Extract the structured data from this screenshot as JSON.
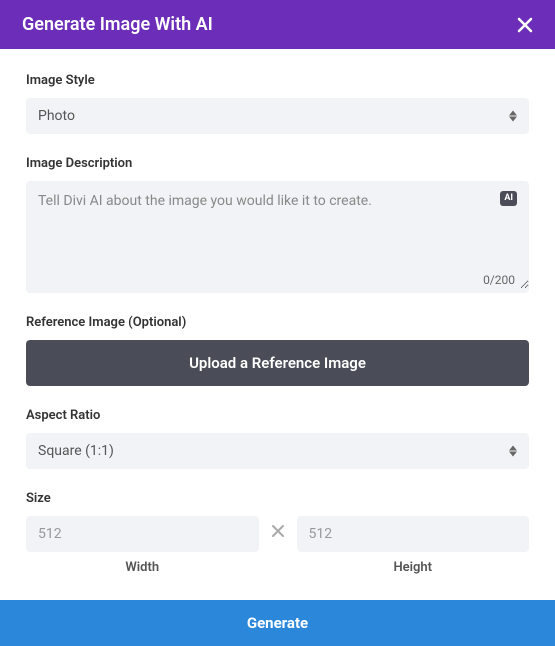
{
  "header": {
    "title": "Generate Image With AI"
  },
  "imageStyle": {
    "label": "Image Style",
    "selected": "Photo"
  },
  "imageDescription": {
    "label": "Image Description",
    "placeholder": "Tell Divi AI about the image you would like it to create.",
    "aiBadge": "AI",
    "charCount": "0/200"
  },
  "referenceImage": {
    "label": "Reference Image (Optional)",
    "buttonLabel": "Upload a Reference Image"
  },
  "aspectRatio": {
    "label": "Aspect Ratio",
    "selected": "Square (1:1)"
  },
  "size": {
    "label": "Size",
    "widthPlaceholder": "512",
    "heightPlaceholder": "512",
    "widthLabel": "Width",
    "heightLabel": "Height"
  },
  "footer": {
    "generateLabel": "Generate"
  }
}
